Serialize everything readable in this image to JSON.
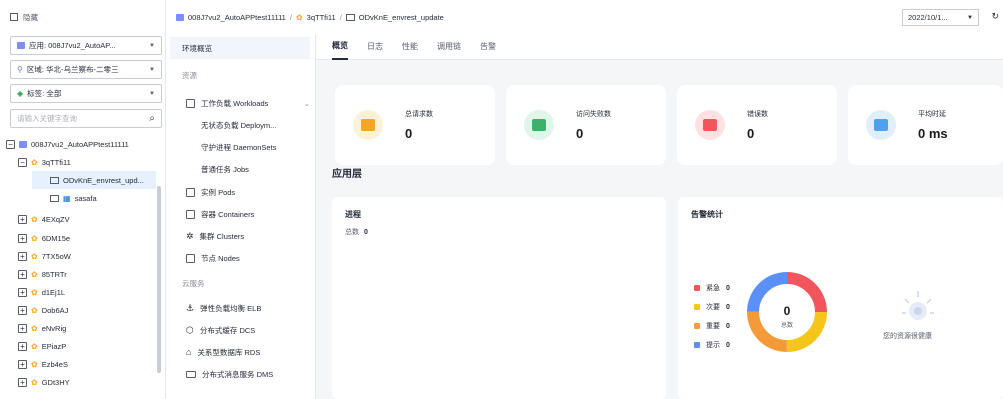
{
  "left": {
    "title": "隐藏",
    "app_select": "应用: 008J7vu2_AutoAP...",
    "region_select": "区域: 华北-乌兰察布-二零三",
    "tag_select": "标签: 全部",
    "search_placeholder": "请输入关键字查询",
    "tree": [
      {
        "label": "008J7vu2_AutoAPPtest11111",
        "level": 0,
        "expand": "−"
      },
      {
        "label": "3qTTfi11",
        "level": 1,
        "expand": "−"
      },
      {
        "label": "ODvKnE_envrest_upd...",
        "level": 2,
        "selected": true
      },
      {
        "label": "sasafa",
        "level": 2
      },
      {
        "label": "4EXqZV",
        "level": 1,
        "expand": "+"
      },
      {
        "label": "6DM15e",
        "level": 1,
        "expand": "+"
      },
      {
        "label": "7TX5oW",
        "level": 1,
        "expand": "+"
      },
      {
        "label": "85TRTr",
        "level": 1,
        "expand": "+"
      },
      {
        "label": "d1Ej1L",
        "level": 1,
        "expand": "+"
      },
      {
        "label": "Dob6AJ",
        "level": 1,
        "expand": "+"
      },
      {
        "label": "eNvRig",
        "level": 1,
        "expand": "+"
      },
      {
        "label": "EPiazP",
        "level": 1,
        "expand": "+"
      },
      {
        "label": "Ezb4eS",
        "level": 1,
        "expand": "+"
      },
      {
        "label": "GDt3HY",
        "level": 1,
        "expand": "+"
      }
    ]
  },
  "breadcrumb": {
    "app": "008J7vu2_AutoAPPtest11111",
    "sep": "/",
    "component": "3qTTfi11",
    "env": "ODvKnE_envrest_update"
  },
  "date_range": "2022/10/1...",
  "refresh_icon": "↻",
  "nav": {
    "overview": "环境概览",
    "resource_header": "资源",
    "workloads": "工作负载 Workloads",
    "deployments": "无状态负载 Deploym...",
    "daemonsets": "守护进程 DaemonSets",
    "jobs": "普通任务 Jobs",
    "pods": "实例 Pods",
    "containers": "容器 Containers",
    "clusters": "集群 Clusters",
    "nodes": "节点 Nodes",
    "cloud_header": "云服务",
    "elb": "弹性负载均衡 ELB",
    "dcs": "分布式缓存 DCS",
    "rds": "关系型数据库 RDS",
    "dms": "分布式消息服务 DMS"
  },
  "tabs": [
    "概览",
    "日志",
    "性能",
    "调用链",
    "告警"
  ],
  "cards": [
    {
      "label": "总请求数",
      "value": "0",
      "color": "#f5a623",
      "bg": "#fdf1d9"
    },
    {
      "label": "访问失败数",
      "value": "0",
      "color": "#3fb06b",
      "bg": "#e1f5e8"
    },
    {
      "label": "错误数",
      "value": "0",
      "color": "#f0565c",
      "bg": "#fde2e3"
    },
    {
      "label": "平均时延",
      "value": "0 ms",
      "color": "#4ba3ef",
      "bg": "#e0effc"
    }
  ],
  "section_title": "应用层",
  "process_panel": {
    "title": "进程",
    "total_label": "总数",
    "total_value": "0"
  },
  "alarm_panel": {
    "title": "告警统计",
    "center_value": "0",
    "center_label": "总数",
    "legend": [
      {
        "label": "紧急",
        "value": "0",
        "color": "#f0565c"
      },
      {
        "label": "次要",
        "value": "0",
        "color": "#f5c518"
      },
      {
        "label": "重要",
        "value": "0",
        "color": "#f29b38"
      },
      {
        "label": "提示",
        "value": "0",
        "color": "#5b8ff9"
      }
    ],
    "healthy_text": "您的资源很健康"
  }
}
